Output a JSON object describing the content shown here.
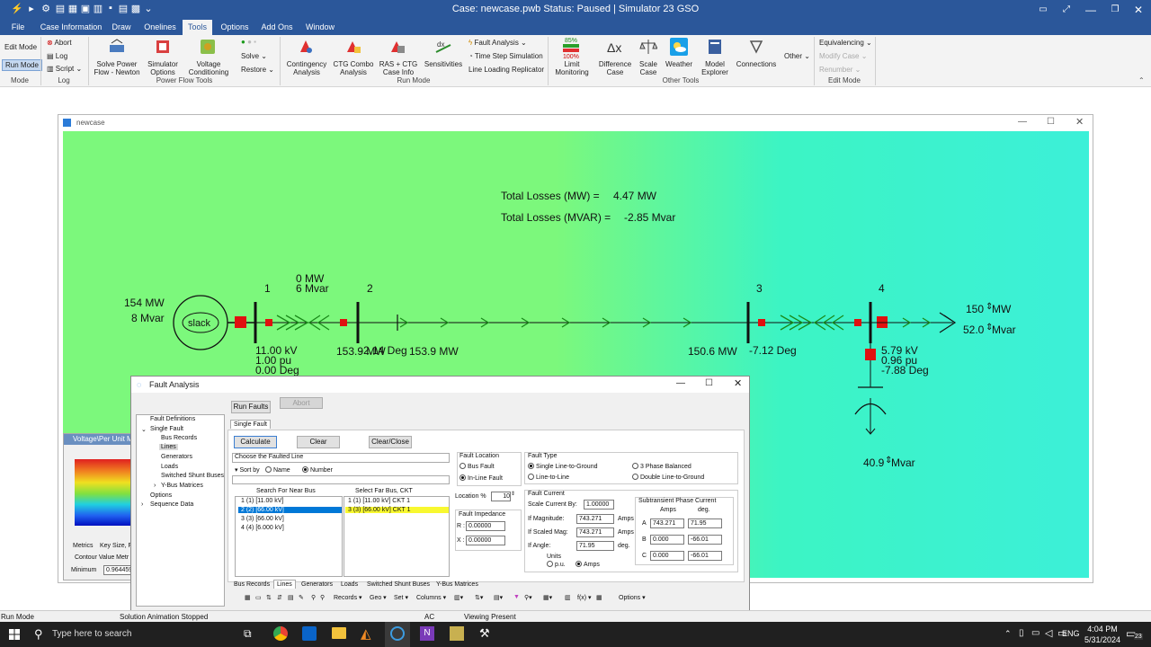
{
  "titlebar": {
    "title": "Case: newcase.pwb  Status: Paused | Simulator 23 GSO"
  },
  "menu": [
    "File",
    "Case Information",
    "Draw",
    "Onelines",
    "Tools",
    "Options",
    "Add Ons",
    "Window"
  ],
  "ribbon": {
    "mode": {
      "edit": "Edit Mode",
      "run": "Run Mode",
      "group": "Mode"
    },
    "log": {
      "abort": "Abort",
      "log": "Log",
      "script": "Script",
      "group": "Log"
    },
    "pft": {
      "solve_power_flow": "Solve Power Flow - Newton",
      "simulator_options": "Simulator Options",
      "voltage_conditioning": "Voltage Conditioning",
      "solve": "Solve",
      "restore": "Restore",
      "group": "Power Flow Tools"
    },
    "run": {
      "contingency": "Contingency Analysis",
      "ctg_combo": "CTG Combo Analysis",
      "ras_ctg": "RAS + CTG Case Info",
      "sensitivities": "Sensitivities",
      "fault_analysis": "Fault Analysis",
      "time_step": "Time Step Simulation",
      "line_loading": "Line Loading Replicator",
      "group": "Run Mode"
    },
    "other": {
      "limit_monitoring": "Limit Monitoring",
      "difference_case": "Difference Case",
      "scale_case": "Scale Case",
      "weather": "Weather",
      "model_explorer": "Model Explorer",
      "connections": "Connections",
      "other": "Other",
      "group": "Other Tools",
      "pct85": "85%",
      "pct100": "100%"
    },
    "edit": {
      "equivalencing": "Equivalencing",
      "modify_case": "Modify Case",
      "renumber": "Renumber",
      "group": "Edit Mode"
    }
  },
  "oneline": {
    "window_title": "newcase",
    "total_losses_mw_label": "Total Losses (MW) =",
    "total_losses_mw_value": "4.47 MW",
    "total_losses_mvar_label": "Total Losses (MVAR) =",
    "total_losses_mvar_value": "-2.85 Mvar",
    "gen_mw": "154 MW",
    "gen_mvar": "8 Mvar",
    "slack": "slack",
    "bus1": "1",
    "bus2": "2",
    "bus3": "3",
    "bus4": "4",
    "mid_mw": "0 MW",
    "mid_mvar": "6 Mvar",
    "bus1_kv": "11.00 kV",
    "bus1_pu": "1.00 pu",
    "bus1_deg": "0.00 Deg",
    "line2_flow_left": "153.9 MW",
    "line2_deg": "-2.14 Deg",
    "line2_flow_right": "153.9 MW",
    "bus3_flow": "150.6 MW",
    "bus3_deg": "-7.12 Deg",
    "bus4_kv": "5.79 kV",
    "bus4_pu": "0.96 pu",
    "bus4_deg": "-7.88 Deg",
    "load_mw": "150",
    "load_mw_unit": "MW",
    "load_mvar": "52.0",
    "load_mvar_unit": "Mvar",
    "shunt_mvar": "40.9",
    "shunt_mvar_unit": "Mvar"
  },
  "contour_panel": {
    "title": "Voltage\\Per Unit M",
    "tab_metrics": "Metrics",
    "tab_keysize": "Key Size, F",
    "contour_value": "Contour Value Metr",
    "minimum_label": "Minimum",
    "minimum_value": "0.964459"
  },
  "fault": {
    "title": "Fault Analysis",
    "run_faults": "Run Faults",
    "abort": "Abort",
    "tree": [
      "Fault Definitions",
      "Single Fault",
      "Bus Records",
      "Lines",
      "Generators",
      "Loads",
      "Switched Shunt Buses",
      "Y-Bus Matrices",
      "Options",
      "Sequence Data"
    ],
    "tab_single": "Single Fault",
    "calculate": "Calculate",
    "clear": "Clear",
    "clear_close": "Clear/Close",
    "choose_line": "Choose the Faulted Line",
    "sort_by": "Sort by",
    "sort_name": "Name",
    "sort_number": "Number",
    "search_near": "Search For Near Bus",
    "select_far": "Select Far Bus, CKT",
    "near_buses": [
      "1 (1)  [11.00 kV]",
      "2 (2)  [66.00 kV]",
      "3 (3)  [66.00 kV]",
      "4 (4)  [6.000 kV]"
    ],
    "far_buses": [
      "1 (1) [11.00 kV] CKT  1",
      "3 (3) [66.00 kV] CKT  1"
    ],
    "fault_location": "Fault Location",
    "bus_fault": "Bus Fault",
    "inline_fault": "In-Line Fault",
    "location_pct": "Location %",
    "location_val": "10",
    "fault_impedance": "Fault Impedance",
    "r_label": "R :",
    "r_val": "0.00000",
    "x_label": "X :",
    "x_val": "0.00000",
    "fault_type": "Fault Type",
    "slg": "Single Line-to-Ground",
    "three_phase": "3 Phase Balanced",
    "ll": "Line-to-Line",
    "dlg": "Double Line-to-Ground",
    "fault_current": "Fault Current",
    "scale_by": "Scale Current By:",
    "scale_val": "1.00000",
    "if_mag": "If Magnitude:",
    "if_mag_val": "743.271",
    "if_scaled": "If Scaled Mag:",
    "if_scaled_val": "743.271",
    "if_angle": "If Angle:",
    "if_angle_val": "71.95",
    "amps": "Amps",
    "deg": "deg.",
    "units": "Units",
    "pu": "p.u.",
    "units_amps": "Amps",
    "subtransient": "Subtransient Phase Current",
    "col_amps": "Amps",
    "col_deg": "deg.",
    "phaseA": "A",
    "a_amps": "743.271",
    "a_deg": "71.95",
    "phaseB": "B",
    "b_amps": "0.000",
    "b_deg": "-66.01",
    "phaseC": "C",
    "c_amps": "0.000",
    "c_deg": "-66.01",
    "bottom_tabs": [
      "Bus Records",
      "Lines",
      "Generators",
      "Loads",
      "Switched Shunt Buses",
      "Y-Bus Matrices"
    ],
    "toolbar": {
      "records": "Records",
      "geo": "Geo",
      "set": "Set",
      "columns": "Columns",
      "fx": "f(x)",
      "options": "Options"
    }
  },
  "status": {
    "mode": "Run Mode",
    "animation": "Solution Animation Stopped",
    "ac": "AC",
    "viewing": "Viewing Present"
  },
  "taskbar": {
    "search": "Type here to search",
    "lang": "ENG",
    "time": "4:04 PM",
    "date": "5/31/2024",
    "notif": "23"
  }
}
